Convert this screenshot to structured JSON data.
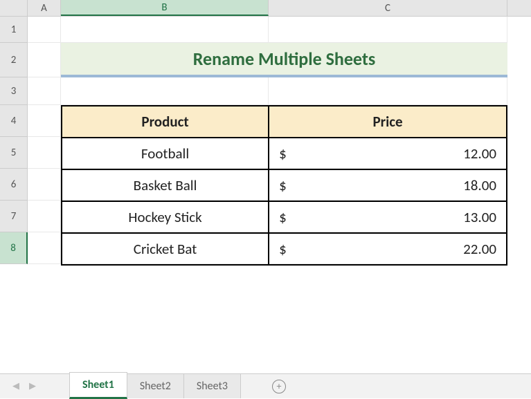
{
  "columns": {
    "a": "A",
    "b": "B",
    "c": "C"
  },
  "rows": [
    "1",
    "2",
    "3",
    "4",
    "5",
    "6",
    "7",
    "8"
  ],
  "title": "Rename Multiple Sheets",
  "table": {
    "headers": {
      "product": "Product",
      "price": "Price"
    },
    "rows": [
      {
        "product": "Football",
        "currency": "$",
        "price": "12.00"
      },
      {
        "product": "Basket Ball",
        "currency": "$",
        "price": "18.00"
      },
      {
        "product": "Hockey Stick",
        "currency": "$",
        "price": "13.00"
      },
      {
        "product": "Cricket Bat",
        "currency": "$",
        "price": "22.00"
      }
    ]
  },
  "sheets": {
    "tabs": [
      "Sheet1",
      "Sheet2",
      "Sheet3"
    ],
    "active": "Sheet1"
  },
  "chart_data": {
    "type": "table",
    "title": "Rename Multiple Sheets",
    "columns": [
      "Product",
      "Price"
    ],
    "rows": [
      [
        "Football",
        12.0
      ],
      [
        "Basket Ball",
        18.0
      ],
      [
        "Hockey Stick",
        13.0
      ],
      [
        "Cricket Bat",
        22.0
      ]
    ],
    "currency": "$"
  }
}
